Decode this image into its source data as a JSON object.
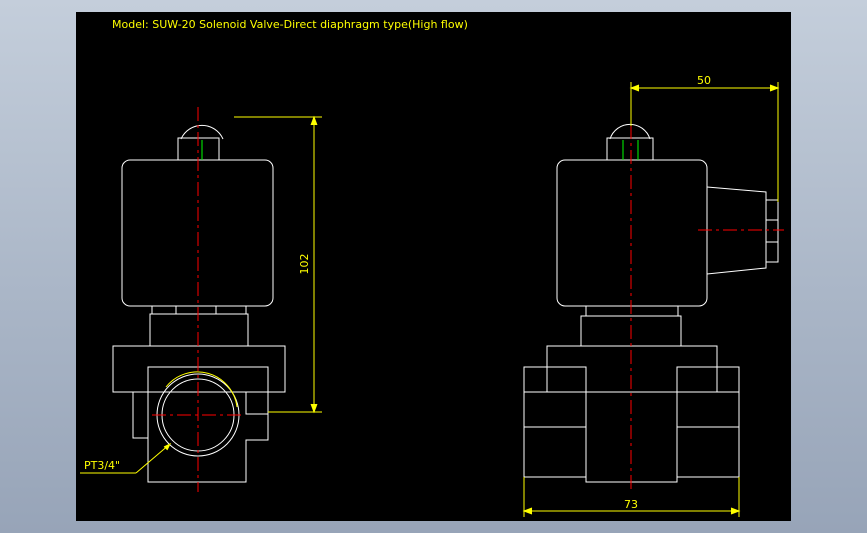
{
  "drawing": {
    "title": "Model: SUW-20 Solenoid Valve-Direct diaphragm type(High flow)",
    "dimensions": {
      "height_left": "102",
      "port_label": "PT3/4\"",
      "coil_offset_right": "50",
      "body_width_right": "73"
    },
    "colors": {
      "background": "#000000",
      "outline": "#ffffff",
      "centerline": "#ff0000",
      "dimension": "#ffff00",
      "highlight": "#00ff00"
    }
  }
}
